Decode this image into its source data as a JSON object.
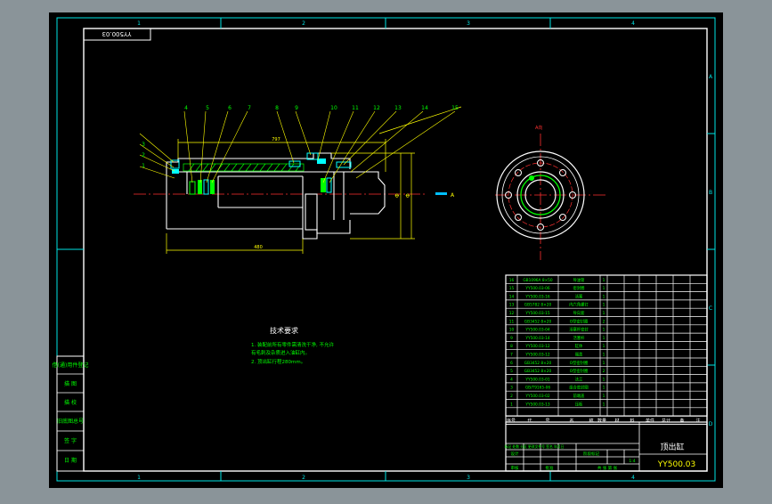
{
  "drawing": {
    "title": "顶出缸",
    "drawing_no": "YY500.03",
    "mirrored_no": "YY500.03",
    "tech_title": "技术要求",
    "tech_notes": [
      "1. 装配前所有零件需清洗干净, 不允许",
      "   有毛刺及杂质进入油缸内。",
      "2. 顶出缸行程280mm。"
    ],
    "view_label": "A向",
    "arrow_label": "A",
    "dim_top": "797",
    "dim_bottom": "480",
    "dim_right_1": "Φ",
    "dim_right_2": "Φ"
  },
  "zone_columns": [
    "1",
    "2",
    "3",
    "4"
  ],
  "zone_rows": [
    "A",
    "B",
    "C",
    "D"
  ],
  "balloons": [
    "1",
    "2",
    "3",
    "4",
    "5",
    "6",
    "7",
    "8",
    "9",
    "10",
    "11",
    "12",
    "13",
    "14",
    "15"
  ],
  "bom": {
    "header": [
      "序号",
      "代",
      "号",
      "名",
      "称",
      "数量",
      "材",
      "料",
      "单件",
      "总计",
      "备",
      "注"
    ],
    "rows": [
      {
        "no": "16",
        "code": "GB1096A 8×50",
        "name": "导油管",
        "qty": "1"
      },
      {
        "no": "15",
        "code": "YY500.03-06",
        "name": "密封圈",
        "qty": "1"
      },
      {
        "no": "14",
        "code": "YY500.03-16",
        "name": "活塞",
        "qty": "1"
      },
      {
        "no": "13",
        "code": "GB5782 8×20",
        "name": "内六角螺钉",
        "qty": "1"
      },
      {
        "no": "12",
        "code": "YY500.03-15",
        "name": "导向套",
        "qty": "1"
      },
      {
        "no": "11",
        "code": "GB3452 8×20",
        "name": "O型密封圈",
        "qty": "2"
      },
      {
        "no": "10",
        "code": "YY500.03-04",
        "name": "活塞杆密封",
        "qty": "1"
      },
      {
        "no": "9",
        "code": "YY500.03-14",
        "name": "活塞杆",
        "qty": "1"
      },
      {
        "no": "8",
        "code": "YY500.03-12",
        "name": "缸体",
        "qty": "1"
      },
      {
        "no": "7",
        "code": "YY500.03-12",
        "name": "端盖",
        "qty": "1"
      },
      {
        "no": "6",
        "code": "GB3452 8×20",
        "name": "O型密封圈",
        "qty": "1"
      },
      {
        "no": "5",
        "code": "GB3452 8×20",
        "name": "O型密封圈",
        "qty": "2"
      },
      {
        "no": "4",
        "code": "YY500.03-01",
        "name": "法兰",
        "qty": "1"
      },
      {
        "no": "3",
        "code": "GB/T9165-06",
        "name": "组合密封圈",
        "qty": "1"
      },
      {
        "no": "2",
        "code": "YY500.03-02",
        "name": "前端盖",
        "qty": "1"
      },
      {
        "no": "1",
        "code": "YY500.03-13",
        "name": "压板",
        "qty": "1"
      }
    ]
  },
  "title_block": {
    "designer_row": "标记 处数 分区 更改文件号 签名 年月日",
    "design": "设计",
    "stage": "阶段标记",
    "scale": "1:4",
    "check": "审核",
    "approve": "批准",
    "sheet": "共 张 第 张"
  },
  "side_table": [
    "借(通)用件登记",
    "描 图",
    "描 校",
    "旧底图总号",
    "签 字",
    "日 期"
  ],
  "colors": {
    "background": "#000000",
    "outer": "#8a9499",
    "frame": "#ffffff",
    "line": "#00ff00",
    "cyan": "#00ffff",
    "center": "#ff0000",
    "yellow": "#ffff00",
    "blue": "#3366ff"
  }
}
